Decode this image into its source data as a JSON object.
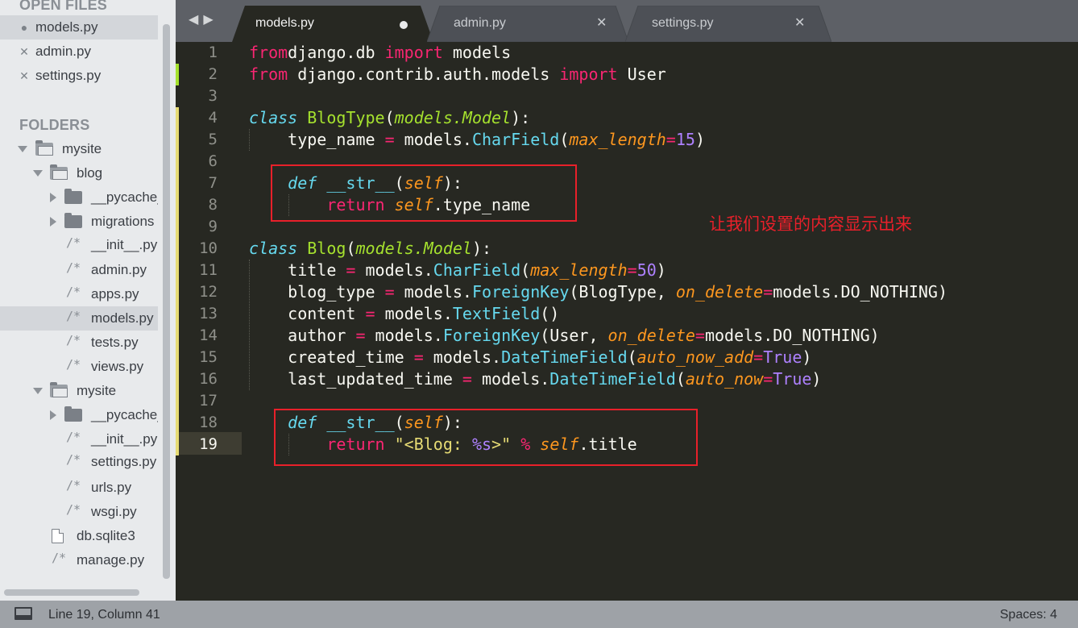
{
  "sidebar": {
    "open_files_header": "OPEN FILES",
    "open_files": [
      {
        "name": "models.py",
        "state": "modified",
        "mark": "●"
      },
      {
        "name": "admin.py",
        "state": "saved",
        "mark": "✕"
      },
      {
        "name": "settings.py",
        "state": "saved",
        "mark": "✕"
      }
    ],
    "folders_header": "FOLDERS",
    "tree": [
      {
        "label": "mysite",
        "type": "folder-open"
      },
      {
        "label": "blog",
        "type": "folder-open"
      },
      {
        "label": "__pycache_",
        "type": "folder"
      },
      {
        "label": "migrations",
        "type": "folder"
      },
      {
        "label": "__init__.py",
        "type": "file"
      },
      {
        "label": "admin.py",
        "type": "file"
      },
      {
        "label": "apps.py",
        "type": "file"
      },
      {
        "label": "models.py",
        "type": "file"
      },
      {
        "label": "tests.py",
        "type": "file"
      },
      {
        "label": "views.py",
        "type": "file"
      },
      {
        "label": "mysite",
        "type": "folder-open"
      },
      {
        "label": "__pycache_",
        "type": "folder"
      },
      {
        "label": "__init__.py",
        "type": "file"
      },
      {
        "label": "settings.py",
        "type": "file"
      },
      {
        "label": "urls.py",
        "type": "file"
      },
      {
        "label": "wsgi.py",
        "type": "file"
      },
      {
        "label": "db.sqlite3",
        "type": "doc"
      },
      {
        "label": "manage.py",
        "type": "file"
      }
    ],
    "file_icon_glyph": "/*"
  },
  "nav": {
    "back": "◀",
    "forward": "▶"
  },
  "tabs": [
    {
      "label": "models.py",
      "active": true,
      "modified": true
    },
    {
      "label": "admin.py",
      "active": false,
      "close": "✕"
    },
    {
      "label": "settings.py",
      "active": false,
      "close": "✕"
    }
  ],
  "editor": {
    "line_numbers": [
      "1",
      "2",
      "3",
      "4",
      "5",
      "6",
      "7",
      "8",
      "9",
      "10",
      "11",
      "12",
      "13",
      "14",
      "15",
      "16",
      "17",
      "18",
      "19"
    ],
    "active_line": "19",
    "lines": [
      [
        [
          "kw",
          "from"
        ],
        [
          "",
          "django.db "
        ],
        [
          "kw",
          "import"
        ],
        [
          "",
          " models"
        ]
      ],
      [
        [
          "kw",
          "from"
        ],
        [
          "",
          " django.contrib.auth.models "
        ],
        [
          "kw",
          "import"
        ],
        [
          "",
          " User"
        ]
      ],
      [],
      [
        [
          "st",
          "class"
        ],
        [
          "",
          " "
        ],
        [
          "cls",
          "BlogType"
        ],
        [
          "",
          "("
        ],
        [
          "inh",
          "models.Model"
        ],
        [
          "",
          "):"
        ]
      ],
      [
        [
          "",
          "    type_name "
        ],
        [
          "kw",
          "="
        ],
        [
          "",
          " models."
        ],
        [
          "fn",
          "CharField"
        ],
        [
          "",
          "("
        ],
        [
          "par",
          "max_length"
        ],
        [
          "kw",
          "="
        ],
        [
          "num",
          "15"
        ],
        [
          "",
          ")"
        ]
      ],
      [],
      [
        [
          "",
          "    "
        ],
        [
          "st",
          "def"
        ],
        [
          "",
          " "
        ],
        [
          "fn",
          "__str__"
        ],
        [
          "",
          "("
        ],
        [
          "par",
          "self"
        ],
        [
          "",
          "):"
        ]
      ],
      [
        [
          "",
          "        "
        ],
        [
          "kw",
          "return"
        ],
        [
          "",
          " "
        ],
        [
          "par",
          "self"
        ],
        [
          "",
          ".type_name"
        ]
      ],
      [],
      [
        [
          "st",
          "class"
        ],
        [
          "",
          " "
        ],
        [
          "cls",
          "Blog"
        ],
        [
          "",
          "("
        ],
        [
          "inh",
          "models.Model"
        ],
        [
          "",
          "):"
        ]
      ],
      [
        [
          "",
          "    title "
        ],
        [
          "kw",
          "="
        ],
        [
          "",
          " models."
        ],
        [
          "fn",
          "CharField"
        ],
        [
          "",
          "("
        ],
        [
          "par",
          "max_length"
        ],
        [
          "kw",
          "="
        ],
        [
          "num",
          "50"
        ],
        [
          "",
          ")"
        ]
      ],
      [
        [
          "",
          "    blog_type "
        ],
        [
          "kw",
          "="
        ],
        [
          "",
          " models."
        ],
        [
          "fn",
          "ForeignKey"
        ],
        [
          "",
          "(BlogType, "
        ],
        [
          "par",
          "on_delete"
        ],
        [
          "kw",
          "="
        ],
        [
          "",
          "models.DO_NOTHING)"
        ]
      ],
      [
        [
          "",
          "    content "
        ],
        [
          "kw",
          "="
        ],
        [
          "",
          " models."
        ],
        [
          "fn",
          "TextField"
        ],
        [
          "",
          "()"
        ]
      ],
      [
        [
          "",
          "    author "
        ],
        [
          "kw",
          "="
        ],
        [
          "",
          " models."
        ],
        [
          "fn",
          "ForeignKey"
        ],
        [
          "",
          "(User, "
        ],
        [
          "par",
          "on_delete"
        ],
        [
          "kw",
          "="
        ],
        [
          "",
          "models.DO_NOTHING)"
        ]
      ],
      [
        [
          "",
          "    created_time "
        ],
        [
          "kw",
          "="
        ],
        [
          "",
          " models."
        ],
        [
          "fn",
          "DateTimeField"
        ],
        [
          "",
          "("
        ],
        [
          "par",
          "auto_now_add"
        ],
        [
          "kw",
          "="
        ],
        [
          "num",
          "True"
        ],
        [
          "",
          ")"
        ]
      ],
      [
        [
          "",
          "    last_updated_time "
        ],
        [
          "kw",
          "="
        ],
        [
          "",
          " models."
        ],
        [
          "fn",
          "DateTimeField"
        ],
        [
          "",
          "("
        ],
        [
          "par",
          "auto_now"
        ],
        [
          "kw",
          "="
        ],
        [
          "num",
          "True"
        ],
        [
          "",
          ")"
        ]
      ],
      [],
      [
        [
          "",
          "    "
        ],
        [
          "st",
          "def"
        ],
        [
          "",
          " "
        ],
        [
          "fn",
          "__str__"
        ],
        [
          "",
          "("
        ],
        [
          "par",
          "self"
        ],
        [
          "",
          "):"
        ]
      ],
      [
        [
          "",
          "        "
        ],
        [
          "kw",
          "return"
        ],
        [
          "",
          " "
        ],
        [
          "str",
          "\"<Blog: "
        ],
        [
          "num",
          "%s"
        ],
        [
          "str",
          ">\""
        ],
        [
          "",
          " "
        ],
        [
          "kw",
          "%"
        ],
        [
          "",
          " "
        ],
        [
          "par",
          "self"
        ],
        [
          "",
          ".title"
        ]
      ]
    ],
    "annotation": "让我们设置的内容显示出来"
  },
  "status": {
    "position": "Line 19, Column 41",
    "indent": "Spaces: 4"
  },
  "colors": {
    "editor_bg": "#272822",
    "keyword": "#f92672",
    "storage": "#66d9ef",
    "class_name": "#a6e22e",
    "parameter": "#fd971f",
    "number": "#ae81ff",
    "string": "#e6db74",
    "annotation_red": "#e8202a"
  }
}
